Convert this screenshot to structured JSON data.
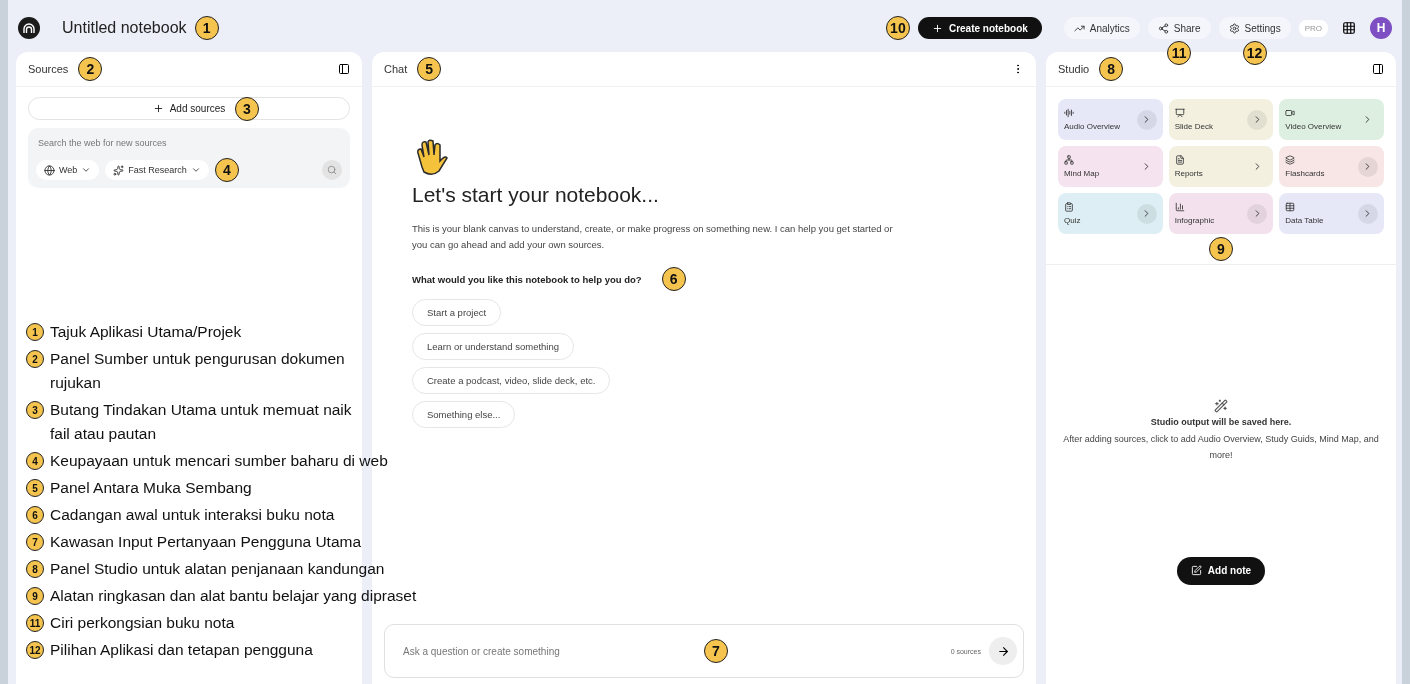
{
  "header": {
    "title": "Untitled notebook",
    "marker": "1",
    "create_button": {
      "label": "Create notebook",
      "marker": "10"
    },
    "actions": [
      {
        "kind": "analytics",
        "label": "Analytics"
      },
      {
        "kind": "share",
        "label": "Share",
        "marker": "11"
      },
      {
        "kind": "settings",
        "label": "Settings",
        "marker": "12"
      }
    ],
    "plan_badge": "PRO",
    "avatar": "H"
  },
  "sources": {
    "title": "Sources",
    "marker": "2",
    "add_button": {
      "label": "Add sources",
      "marker": "3"
    },
    "web_search": {
      "placeholder": "Search the web for new sources",
      "marker": "4",
      "filters": [
        {
          "kind": "web",
          "label": "Web"
        },
        {
          "kind": "research",
          "label": "Fast Research"
        }
      ]
    }
  },
  "chat": {
    "title": "Chat",
    "marker": "5",
    "heading": "Let's start your notebook...",
    "intro": "This is your blank canvas to understand, create, or make progress on something new. I can help you get started or you can go ahead and add your own sources.",
    "question": "What would you like this notebook to help you do?",
    "question_marker": "6",
    "suggestions": [
      "Start a project",
      "Learn or understand something",
      "Create a podcast, video, slide deck, etc.",
      "Something else..."
    ],
    "input": {
      "placeholder": "Ask a question or create something",
      "marker": "7",
      "source_count": "0 sources"
    }
  },
  "studio": {
    "title": "Studio",
    "marker": "8",
    "tools_marker": "9",
    "tools": [
      {
        "kind": "audio",
        "label": "Audio Overview",
        "color": "#e6e8f8",
        "round_arrow": true
      },
      {
        "kind": "slides",
        "label": "Slide Deck",
        "color": "#f3f0e0",
        "round_arrow": true
      },
      {
        "kind": "video",
        "label": "Video Overview",
        "color": "#dcefe0",
        "round_arrow": false
      },
      {
        "kind": "mindmap",
        "label": "Mind Map",
        "color": "#f5e3ef",
        "round_arrow": false
      },
      {
        "kind": "reports",
        "label": "Reports",
        "color": "#f3f0e0",
        "round_arrow": false
      },
      {
        "kind": "flashcards",
        "label": "Flashcards",
        "color": "#f8e6e6",
        "round_arrow": true
      },
      {
        "kind": "quiz",
        "label": "Quiz",
        "color": "#ddeff5",
        "round_arrow": true
      },
      {
        "kind": "infographic",
        "label": "Infographic",
        "color": "#f3e2ee",
        "round_arrow": true
      },
      {
        "kind": "table",
        "label": "Data Table",
        "color": "#e6e8f8",
        "round_arrow": true
      }
    ],
    "empty_title": "Studio output will be saved here.",
    "empty_text": "After adding sources, click to add Audio Overview, Study Guids, Mind Map, and more!",
    "add_note": "Add note"
  },
  "legend": [
    {
      "number": "1",
      "text": "Tajuk Aplikasi Utama/Projek"
    },
    {
      "number": "2",
      "text": "Panel Sumber untuk pengurusan dokumen\nrujukan"
    },
    {
      "number": "3",
      "text": "Butang Tindakan Utama untuk memuat naik\nfail atau pautan"
    },
    {
      "number": "4",
      "text": "Keupayaan untuk mencari sumber baharu di web"
    },
    {
      "number": "5",
      "text": "Panel Antara Muka Sembang"
    },
    {
      "number": "6",
      "text": "Cadangan awal untuk interaksi buku nota"
    },
    {
      "number": "7",
      "text": "Kawasan Input Pertanyaan Pengguna Utama"
    },
    {
      "number": "8",
      "text": "Panel Studio untuk alatan penjanaan kandungan"
    },
    {
      "number": "9",
      "text": "Alatan ringkasan dan alat bantu belajar yang dipraset"
    },
    {
      "number": "11",
      "text": "Ciri perkongsian buku nota"
    },
    {
      "number": "12",
      "text": "Pilihan Aplikasi dan tetapan pengguna"
    }
  ]
}
